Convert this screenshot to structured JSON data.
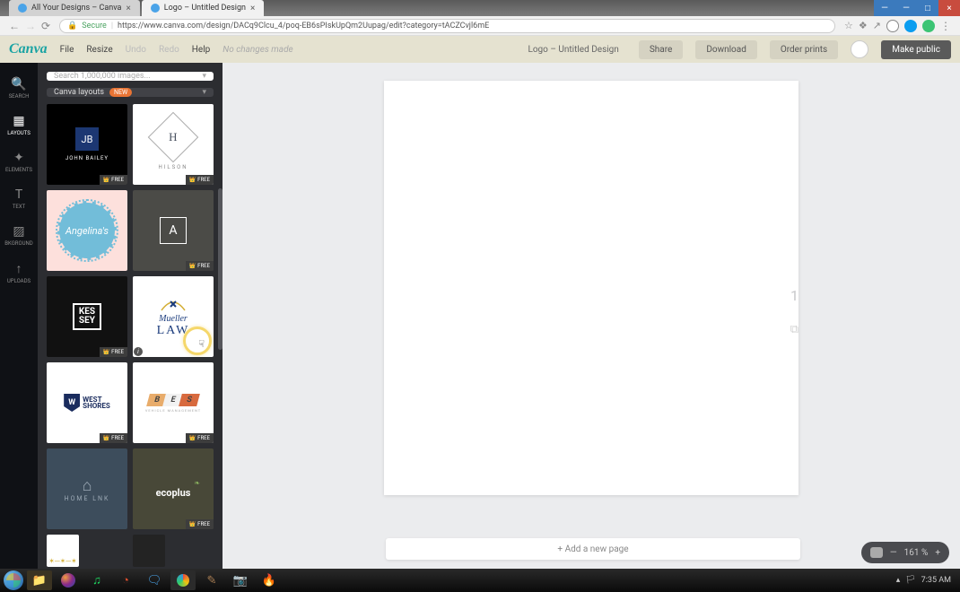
{
  "browser": {
    "tabs": [
      {
        "title": "All Your Designs – Canva",
        "active": false
      },
      {
        "title": "Logo – Untitled Design",
        "active": true
      }
    ],
    "secure_label": "Secure",
    "url": "https://www.canva.com/design/DACq9Clcu_4/poq-EB6sPIskUpQm2Uupag/edit?category=tACZCvjl6mE"
  },
  "toolbar": {
    "file": "File",
    "resize": "Resize",
    "undo": "Undo",
    "redo": "Redo",
    "help": "Help",
    "no_changes": "No changes made",
    "doc_name": "Logo – Untitled Design",
    "share": "Share",
    "download": "Download",
    "order_prints": "Order prints",
    "make_public": "Make public"
  },
  "side_nav": {
    "search": "SEARCH",
    "layouts": "LAYOUTS",
    "elements": "ELEMENTS",
    "text": "TEXT",
    "bkground": "BKGROUND",
    "uploads": "UPLOADS"
  },
  "panel": {
    "search_placeholder": "Search 1,000,000 images...",
    "layouts_label": "Canva layouts",
    "new_badge": "NEW",
    "free": "FREE",
    "templates": {
      "jb_initials": "JB",
      "jb_name": "JOHN BAILEY",
      "hilson_letter": "H",
      "hilson_name": "HILSON",
      "angelina": "Angelina's",
      "a_letter": "A",
      "kessey_l1": "KES",
      "kessey_l2": "SEY",
      "mueller_top": "Mueller",
      "mueller_bottom": "LAW",
      "westshores_w": "W",
      "westshores_l1": "WEST",
      "westshores_l2": "SHORES",
      "bes_b": "B",
      "bes_e": "E",
      "bes_s": "S",
      "bes_sub": "VEHICLE MANAGEMENT",
      "homelink": "HOME LNK",
      "ecoplus": "ecoplus"
    }
  },
  "canvas": {
    "page_number": "1",
    "add_page": "+ Add a new page"
  },
  "zoom": {
    "minus": "—",
    "value": "161 %",
    "plus": "+"
  },
  "tray": {
    "time": "7:35 AM"
  }
}
